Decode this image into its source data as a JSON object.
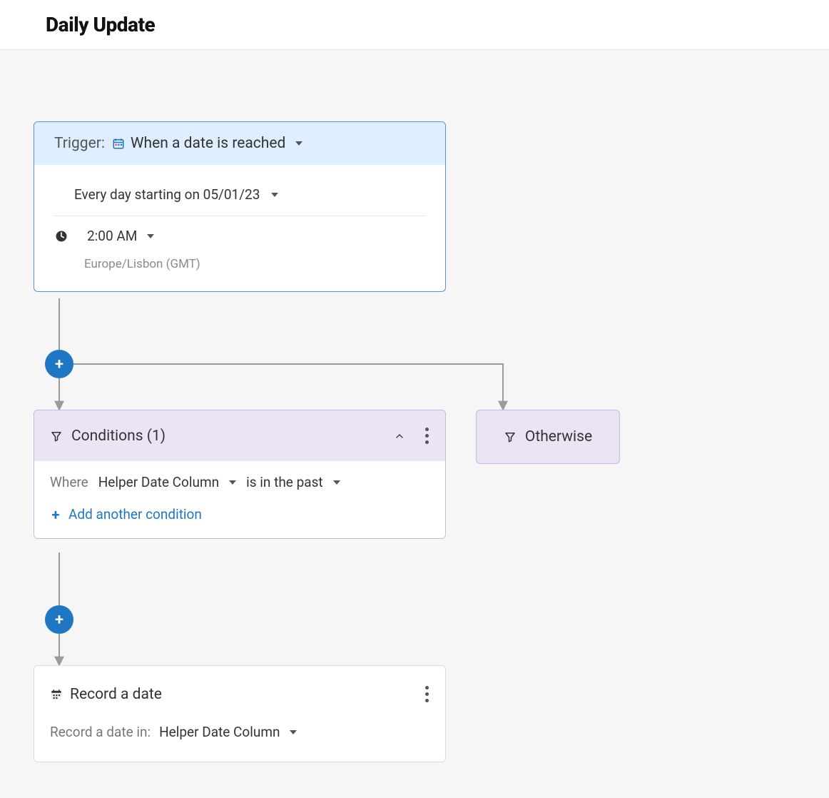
{
  "page": {
    "title": "Daily Update"
  },
  "trigger": {
    "label": "Trigger:",
    "type_label": "When a date is reached",
    "schedule": "Every day starting on 05/01/23",
    "time": "2:00 AM",
    "timezone": "Europe/Lisbon (GMT)"
  },
  "conditions": {
    "title": "Conditions (1)",
    "where_label": "Where",
    "field": "Helper Date Column",
    "operator": "is in the past",
    "add_label": "Add another condition"
  },
  "otherwise": {
    "label": "Otherwise"
  },
  "record": {
    "title": "Record a date",
    "label": "Record a date in:",
    "field": "Helper Date Column"
  },
  "icons": {
    "date": "date-icon",
    "clock": "clock-icon",
    "filter": "filter-icon",
    "calendar": "calendar-icon",
    "plus": "plus-icon",
    "chevron_up": "chevron-up-icon",
    "kebab": "more-icon"
  },
  "colors": {
    "blue_accent": "#1f76c2",
    "trigger_bg": "#dfeeff",
    "trigger_border": "#5b8def",
    "purple_bg": "#ece3f4",
    "purple_border": "#c9b9e0"
  }
}
